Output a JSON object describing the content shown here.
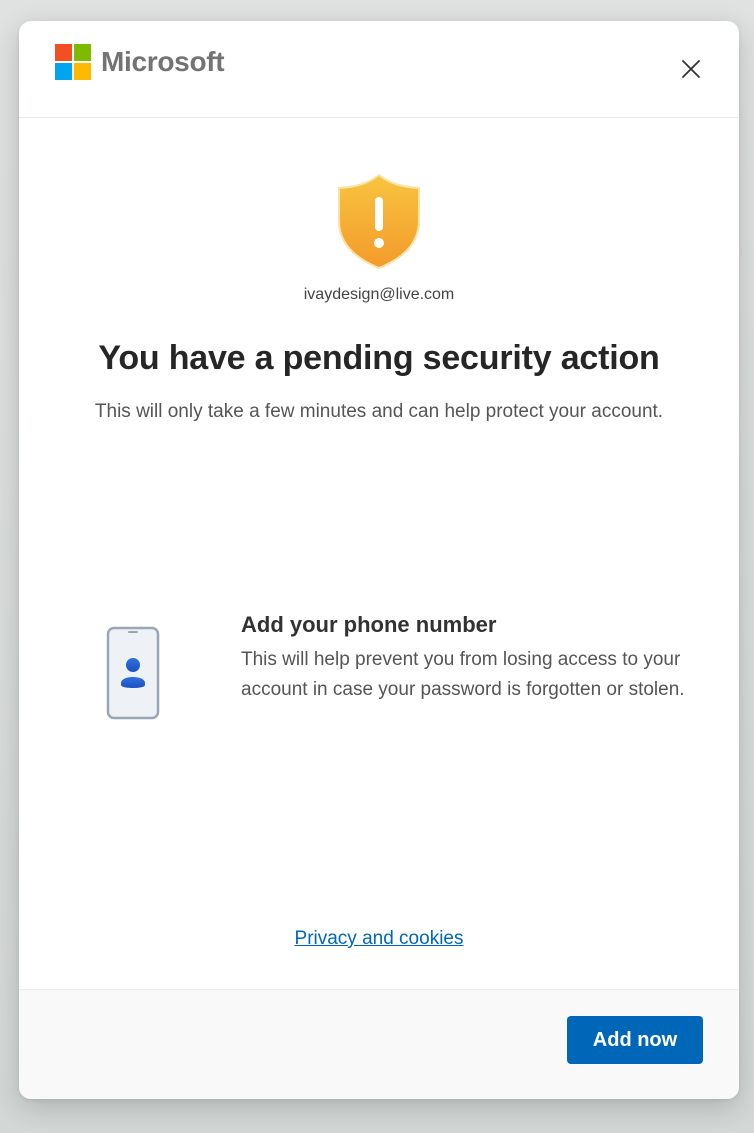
{
  "brand": {
    "name": "Microsoft",
    "logo_colors": [
      "#f25022",
      "#7fba00",
      "#00a4ef",
      "#ffb900"
    ]
  },
  "header": {
    "close_icon": "close-icon"
  },
  "account": {
    "email": "ivaydesign@live.com"
  },
  "main": {
    "icon": "warning-shield-icon",
    "title": "You have a pending security action",
    "subtitle": "This will only take a few minutes and can help protect your account."
  },
  "action": {
    "icon": "phone-person-icon",
    "title": "Add your phone number",
    "description": "This will help prevent you from losing access to your account in case your password is forgotten or stolen."
  },
  "links": {
    "privacy": "Privacy and cookies"
  },
  "footer": {
    "primary_button": "Add now"
  },
  "colors": {
    "accent": "#0067b8",
    "warning_gold": "#f6b93b",
    "warning_orange": "#f49b2a"
  }
}
